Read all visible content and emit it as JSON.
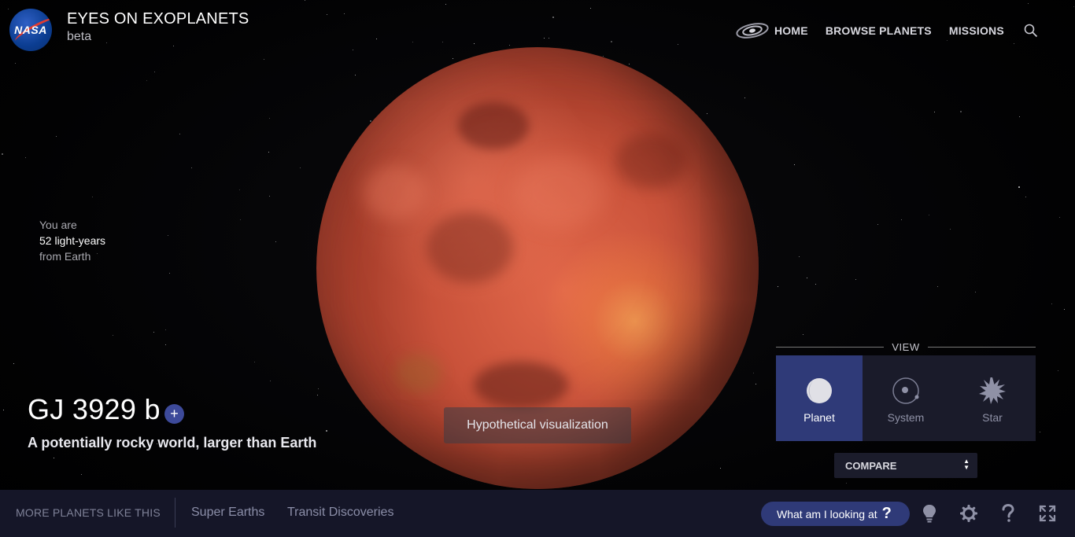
{
  "header": {
    "logo_text": "NASA",
    "title": "EYES ON EXOPLANETS",
    "subtitle": "beta",
    "nav": {
      "home": "HOME",
      "browse": "BROWSE PLANETS",
      "missions": "MISSIONS"
    },
    "icons": [
      "galaxy-icon",
      "search-icon"
    ]
  },
  "distance": {
    "line1": "You are",
    "line2": "52 light-years",
    "line3": "from Earth"
  },
  "planet": {
    "name": "GJ 3929 b",
    "add_label": "+",
    "description": "A potentially rocky world, larger than Earth",
    "visualization_note": "Hypothetical visualization"
  },
  "view": {
    "label": "VIEW",
    "options": [
      {
        "label": "Planet",
        "icon": "planet-icon",
        "active": true
      },
      {
        "label": "System",
        "icon": "system-icon",
        "active": false
      },
      {
        "label": "Star",
        "icon": "star-icon",
        "active": false
      }
    ],
    "compare_label": "COMPARE"
  },
  "bottom": {
    "more_label": "MORE PLANETS LIKE THIS",
    "categories": [
      "Super Earths",
      "Transit Discoveries"
    ],
    "what_label": "What am I looking at",
    "what_icon": "?",
    "tools": [
      "lightbulb-icon",
      "settings-icon",
      "help-icon",
      "fullscreen-icon"
    ]
  },
  "colors": {
    "accent": "#2f3a78",
    "bottom_bar": "#151628",
    "planet": "#c9523a"
  }
}
